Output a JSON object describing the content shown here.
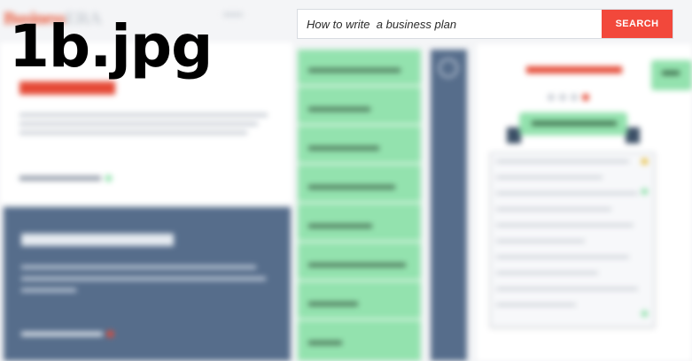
{
  "watermark": "1b.jpg",
  "search": {
    "value": "How to write  a business plan",
    "button_label": "SEARCH"
  },
  "colors": {
    "accent_red": "#f2483b",
    "navy": "#566d8b",
    "mint": "#93e2ae"
  },
  "icons": {
    "access_learn_dot": "square-bullet",
    "learn_dot": "square-bullet",
    "navy_circle": "search-circle-icon",
    "slider_dots": "carousel-dots"
  }
}
